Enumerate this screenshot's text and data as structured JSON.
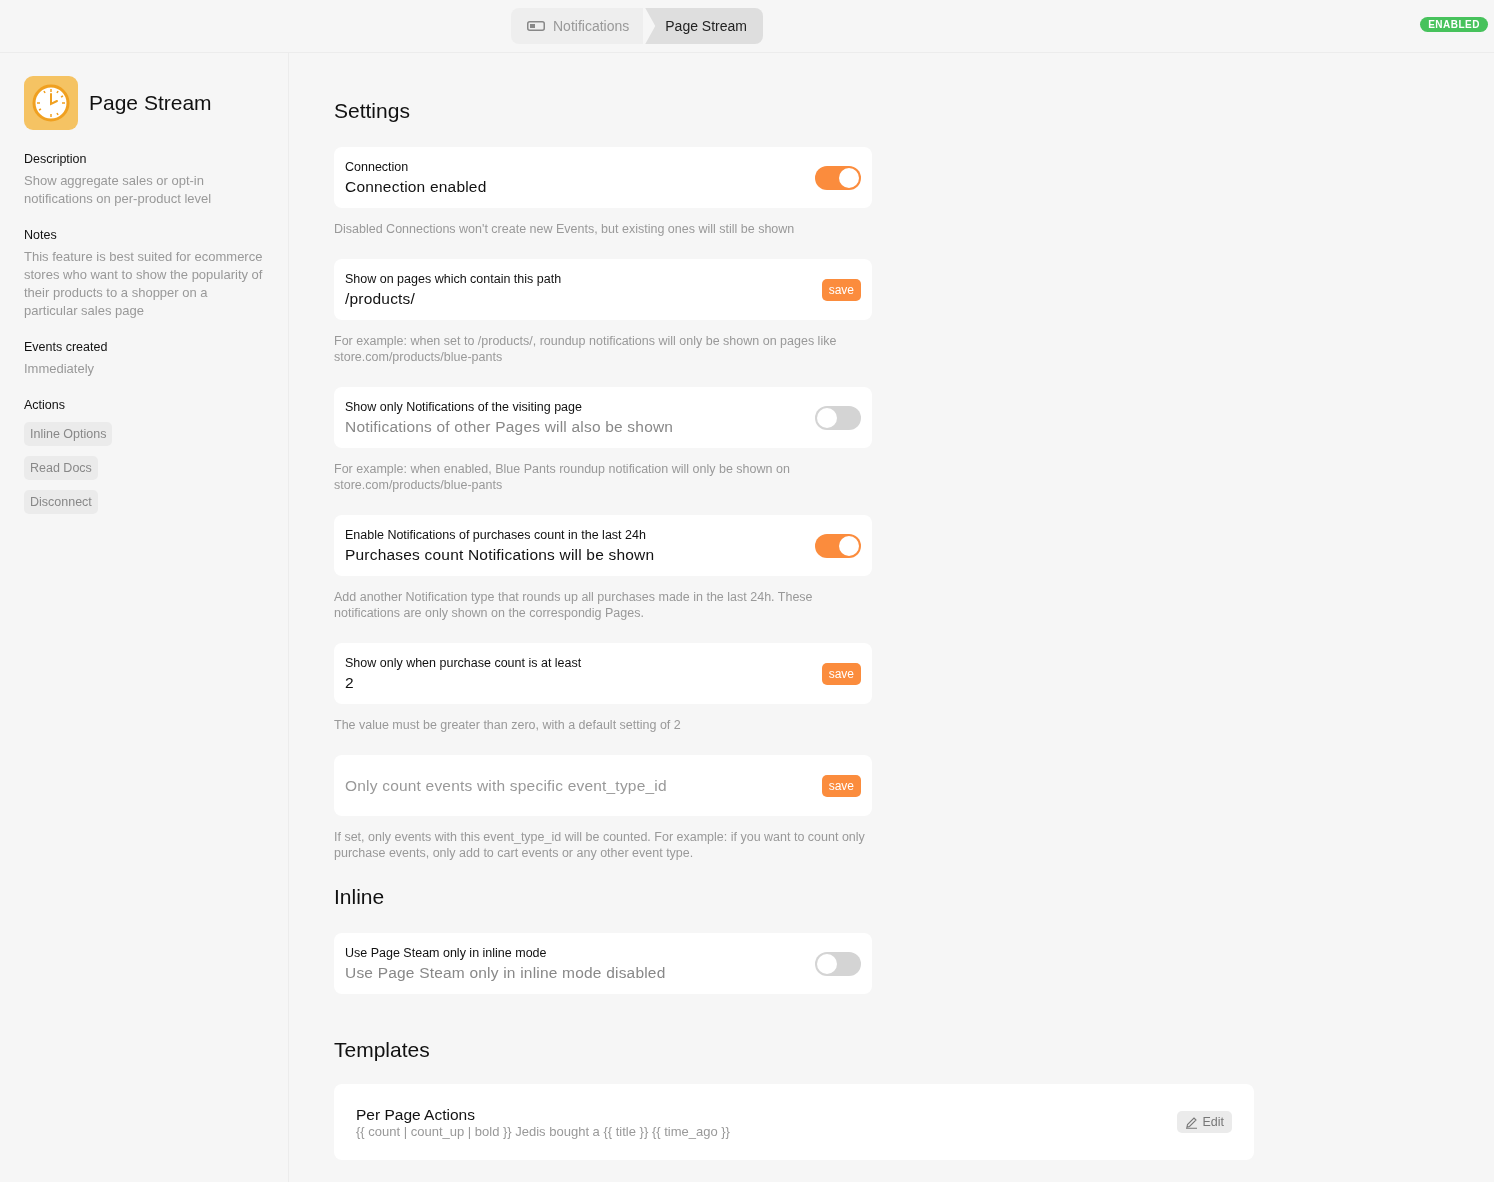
{
  "breadcrumb": [
    {
      "label": "Notifications",
      "selected": false
    },
    {
      "label": "Page Stream",
      "selected": true
    }
  ],
  "status_badge": "ENABLED",
  "sidebar": {
    "title": "Page Stream",
    "sections": [
      {
        "heading": "Description",
        "text": "Show aggregate sales or opt-in notifications on per-product level"
      },
      {
        "heading": "Notes",
        "text": "This feature is best suited for ecommerce stores who want to show the popularity of their products to a shopper on a particular sales page"
      },
      {
        "heading": "Events created",
        "text": "Immediately"
      }
    ],
    "actions_heading": "Actions",
    "actions": [
      "Inline Options",
      "Read Docs",
      "Disconnect"
    ]
  },
  "settings": {
    "heading": "Settings",
    "items": [
      {
        "kind": "toggle",
        "label": "Connection",
        "value": "Connection enabled",
        "on": true,
        "help": "Disabled Connections won't create new Events, but existing ones will still be shown"
      },
      {
        "kind": "input",
        "label": "Show on pages which contain this path",
        "value": "/products/",
        "button": "save",
        "help": "For example: when set to /products/, roundup notifications will only be shown on pages like store.com/products/blue-pants"
      },
      {
        "kind": "toggle",
        "label": "Show only Notifications of the visiting page",
        "value": "Notifications of other Pages will also be shown",
        "on": false,
        "help": "For example: when enabled, Blue Pants roundup notification will only be shown on store.com/products/blue-pants"
      },
      {
        "kind": "toggle",
        "label": "Enable Notifications of purchases count in the last 24h",
        "value": "Purchases count Notifications will be shown",
        "on": true,
        "help": "Add another Notification type that rounds up all purchases made in the last 24h. These notifications are only shown on the correspondig Pages."
      },
      {
        "kind": "input",
        "label": "Show only when purchase count is at least",
        "value": "2",
        "button": "save",
        "help": "The value must be greater than zero, with a default setting of 2"
      },
      {
        "kind": "input",
        "placeholder": "Only count events with specific event_type_id",
        "button": "save",
        "help": "If set, only events with this event_type_id will be counted. For example: if you want to count only purchase events, only add to cart events or any other event type."
      }
    ]
  },
  "inline": {
    "heading": "Inline",
    "items": [
      {
        "kind": "toggle",
        "label": "Use Page Steam only in inline mode",
        "value": "Use Page Steam only in inline mode disabled",
        "on": false
      }
    ]
  },
  "templates": {
    "heading": "Templates",
    "items": [
      {
        "name": "Per Page Actions",
        "template": "{{ count | count_up | bold }} Jedis bought a {{ title }} {{ time_ago }}",
        "button": "Edit"
      }
    ]
  }
}
